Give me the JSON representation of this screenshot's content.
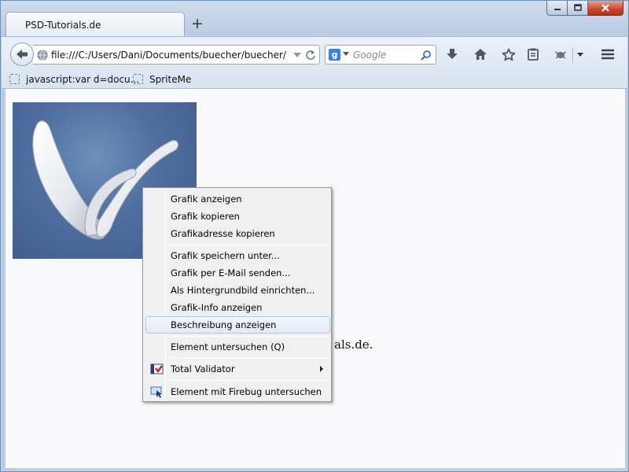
{
  "tab": {
    "title": "PSD-Tutorials.de",
    "new_tab_label": "+"
  },
  "urlbar": {
    "url": "file:///C:/Users/Dani/Documents/buecher/buecher/psd_t"
  },
  "search": {
    "engine_letter": "g",
    "placeholder": "Google"
  },
  "bookmarks": [
    {
      "label": "javascript:var d=docu..."
    },
    {
      "label": "SpriteMe"
    }
  ],
  "page": {
    "partial_text": "als.de."
  },
  "context_menu": {
    "items": [
      {
        "label": "Grafik anzeigen"
      },
      {
        "label": "Grafik kopieren"
      },
      {
        "label": "Grafikadresse kopieren"
      },
      {
        "label": "Grafik speichern unter..."
      },
      {
        "label": "Grafik per E-Mail senden..."
      },
      {
        "label": "Als Hintergrundbild einrichten..."
      },
      {
        "label": "Grafik-Info anzeigen"
      },
      {
        "label": "Beschreibung anzeigen",
        "highlighted": true
      },
      {
        "label": "Element untersuchen (Q)"
      },
      {
        "label": "Total Validator",
        "has_submenu": true,
        "icon": "total-validator-icon"
      },
      {
        "label": "Element mit Firebug untersuchen",
        "icon": "firebug-inspect-icon"
      }
    ]
  },
  "colors": {
    "highlight_border": "#a8c8ef",
    "logo_background": "#4f6e9f",
    "close_button": "#c8452d"
  }
}
